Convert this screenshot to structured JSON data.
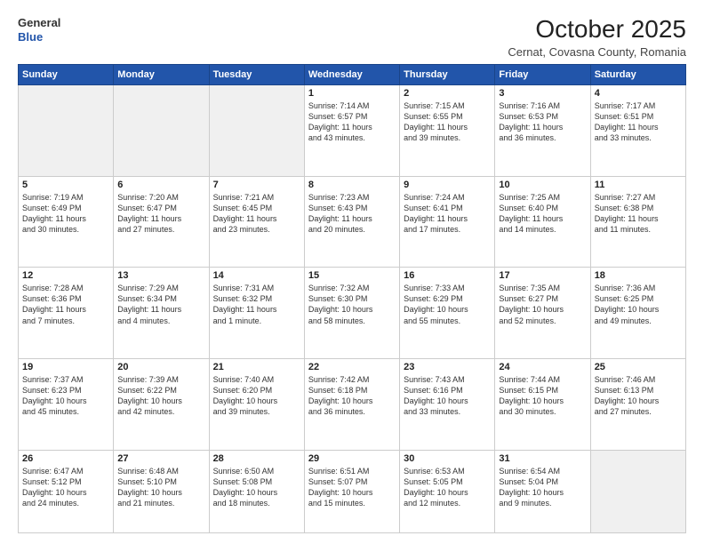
{
  "header": {
    "logo_general": "General",
    "logo_blue": "Blue",
    "month_title": "October 2025",
    "location": "Cernat, Covasna County, Romania"
  },
  "days_of_week": [
    "Sunday",
    "Monday",
    "Tuesday",
    "Wednesday",
    "Thursday",
    "Friday",
    "Saturday"
  ],
  "weeks": [
    [
      {
        "day": "",
        "info": ""
      },
      {
        "day": "",
        "info": ""
      },
      {
        "day": "",
        "info": ""
      },
      {
        "day": "1",
        "info": "Sunrise: 7:14 AM\nSunset: 6:57 PM\nDaylight: 11 hours\nand 43 minutes."
      },
      {
        "day": "2",
        "info": "Sunrise: 7:15 AM\nSunset: 6:55 PM\nDaylight: 11 hours\nand 39 minutes."
      },
      {
        "day": "3",
        "info": "Sunrise: 7:16 AM\nSunset: 6:53 PM\nDaylight: 11 hours\nand 36 minutes."
      },
      {
        "day": "4",
        "info": "Sunrise: 7:17 AM\nSunset: 6:51 PM\nDaylight: 11 hours\nand 33 minutes."
      }
    ],
    [
      {
        "day": "5",
        "info": "Sunrise: 7:19 AM\nSunset: 6:49 PM\nDaylight: 11 hours\nand 30 minutes."
      },
      {
        "day": "6",
        "info": "Sunrise: 7:20 AM\nSunset: 6:47 PM\nDaylight: 11 hours\nand 27 minutes."
      },
      {
        "day": "7",
        "info": "Sunrise: 7:21 AM\nSunset: 6:45 PM\nDaylight: 11 hours\nand 23 minutes."
      },
      {
        "day": "8",
        "info": "Sunrise: 7:23 AM\nSunset: 6:43 PM\nDaylight: 11 hours\nand 20 minutes."
      },
      {
        "day": "9",
        "info": "Sunrise: 7:24 AM\nSunset: 6:41 PM\nDaylight: 11 hours\nand 17 minutes."
      },
      {
        "day": "10",
        "info": "Sunrise: 7:25 AM\nSunset: 6:40 PM\nDaylight: 11 hours\nand 14 minutes."
      },
      {
        "day": "11",
        "info": "Sunrise: 7:27 AM\nSunset: 6:38 PM\nDaylight: 11 hours\nand 11 minutes."
      }
    ],
    [
      {
        "day": "12",
        "info": "Sunrise: 7:28 AM\nSunset: 6:36 PM\nDaylight: 11 hours\nand 7 minutes."
      },
      {
        "day": "13",
        "info": "Sunrise: 7:29 AM\nSunset: 6:34 PM\nDaylight: 11 hours\nand 4 minutes."
      },
      {
        "day": "14",
        "info": "Sunrise: 7:31 AM\nSunset: 6:32 PM\nDaylight: 11 hours\nand 1 minute."
      },
      {
        "day": "15",
        "info": "Sunrise: 7:32 AM\nSunset: 6:30 PM\nDaylight: 10 hours\nand 58 minutes."
      },
      {
        "day": "16",
        "info": "Sunrise: 7:33 AM\nSunset: 6:29 PM\nDaylight: 10 hours\nand 55 minutes."
      },
      {
        "day": "17",
        "info": "Sunrise: 7:35 AM\nSunset: 6:27 PM\nDaylight: 10 hours\nand 52 minutes."
      },
      {
        "day": "18",
        "info": "Sunrise: 7:36 AM\nSunset: 6:25 PM\nDaylight: 10 hours\nand 49 minutes."
      }
    ],
    [
      {
        "day": "19",
        "info": "Sunrise: 7:37 AM\nSunset: 6:23 PM\nDaylight: 10 hours\nand 45 minutes."
      },
      {
        "day": "20",
        "info": "Sunrise: 7:39 AM\nSunset: 6:22 PM\nDaylight: 10 hours\nand 42 minutes."
      },
      {
        "day": "21",
        "info": "Sunrise: 7:40 AM\nSunset: 6:20 PM\nDaylight: 10 hours\nand 39 minutes."
      },
      {
        "day": "22",
        "info": "Sunrise: 7:42 AM\nSunset: 6:18 PM\nDaylight: 10 hours\nand 36 minutes."
      },
      {
        "day": "23",
        "info": "Sunrise: 7:43 AM\nSunset: 6:16 PM\nDaylight: 10 hours\nand 33 minutes."
      },
      {
        "day": "24",
        "info": "Sunrise: 7:44 AM\nSunset: 6:15 PM\nDaylight: 10 hours\nand 30 minutes."
      },
      {
        "day": "25",
        "info": "Sunrise: 7:46 AM\nSunset: 6:13 PM\nDaylight: 10 hours\nand 27 minutes."
      }
    ],
    [
      {
        "day": "26",
        "info": "Sunrise: 6:47 AM\nSunset: 5:12 PM\nDaylight: 10 hours\nand 24 minutes."
      },
      {
        "day": "27",
        "info": "Sunrise: 6:48 AM\nSunset: 5:10 PM\nDaylight: 10 hours\nand 21 minutes."
      },
      {
        "day": "28",
        "info": "Sunrise: 6:50 AM\nSunset: 5:08 PM\nDaylight: 10 hours\nand 18 minutes."
      },
      {
        "day": "29",
        "info": "Sunrise: 6:51 AM\nSunset: 5:07 PM\nDaylight: 10 hours\nand 15 minutes."
      },
      {
        "day": "30",
        "info": "Sunrise: 6:53 AM\nSunset: 5:05 PM\nDaylight: 10 hours\nand 12 minutes."
      },
      {
        "day": "31",
        "info": "Sunrise: 6:54 AM\nSunset: 5:04 PM\nDaylight: 10 hours\nand 9 minutes."
      },
      {
        "day": "",
        "info": ""
      }
    ]
  ]
}
